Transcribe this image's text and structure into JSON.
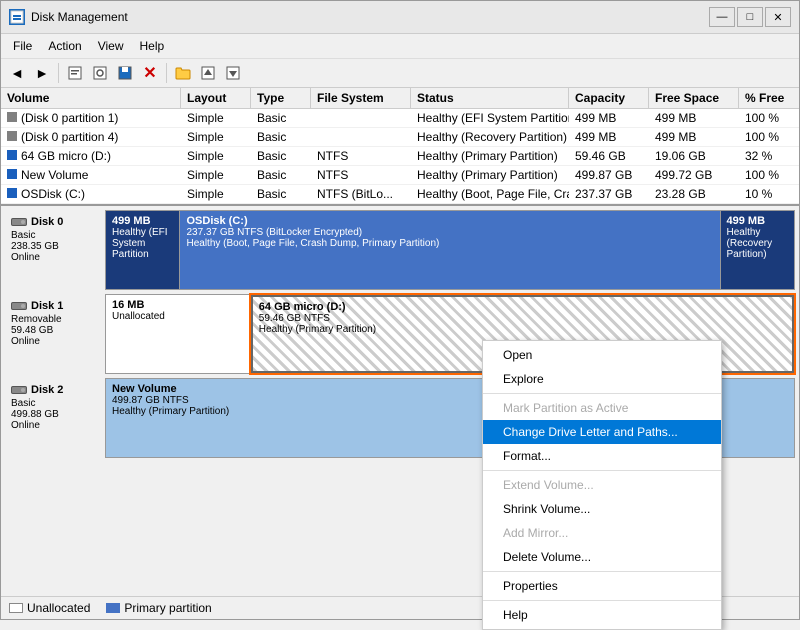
{
  "window": {
    "title": "Disk Management",
    "controls": {
      "minimize": "—",
      "maximize": "□",
      "close": "✕"
    }
  },
  "menu": {
    "items": [
      "File",
      "Action",
      "View",
      "Help"
    ]
  },
  "toolbar": {
    "buttons": [
      "◄",
      "►",
      "📄",
      "🔧",
      "💾",
      "✕",
      "📁",
      "⬆",
      "⬇"
    ]
  },
  "table": {
    "headers": [
      "Volume",
      "Layout",
      "Type",
      "File System",
      "Status",
      "Capacity",
      "Free Space",
      "% Free"
    ],
    "rows": [
      {
        "volume": "(Disk 0 partition 1)",
        "layout": "Simple",
        "type": "Basic",
        "fs": "",
        "status": "Healthy (EFI System Partition)",
        "capacity": "499 MB",
        "free": "499 MB",
        "pct": "100 %"
      },
      {
        "volume": "(Disk 0 partition 4)",
        "layout": "Simple",
        "type": "Basic",
        "fs": "",
        "status": "Healthy (Recovery Partition)",
        "capacity": "499 MB",
        "free": "499 MB",
        "pct": "100 %"
      },
      {
        "volume": "64 GB micro (D:)",
        "layout": "Simple",
        "type": "Basic",
        "fs": "NTFS",
        "status": "Healthy (Primary Partition)",
        "capacity": "59.46 GB",
        "free": "19.06 GB",
        "pct": "32 %"
      },
      {
        "volume": "New Volume",
        "layout": "Simple",
        "type": "Basic",
        "fs": "NTFS",
        "status": "Healthy (Primary Partition)",
        "capacity": "499.87 GB",
        "free": "499.72 GB",
        "pct": "100 %"
      },
      {
        "volume": "OSDisk (C:)",
        "layout": "Simple",
        "type": "Basic",
        "fs": "NTFS (BitLo...",
        "status": "Healthy (Boot, Page File, Crash Dump, Primary Partition)",
        "capacity": "237.37 GB",
        "free": "23.28 GB",
        "pct": "10 %"
      }
    ]
  },
  "disks": [
    {
      "id": "Disk 0",
      "type": "Basic",
      "size": "238.35 GB",
      "status": "Online",
      "partitions": [
        {
          "name": "499 MB",
          "info": "Healthy (EFI System Partition",
          "type": "dark-blue",
          "width": "7"
        },
        {
          "name": "OSDisk (C:)",
          "info2": "237.37 GB NTFS (BitLocker Encrypted)",
          "info": "Healthy (Boot, Page File, Crash Dump, Primary Partition)",
          "type": "medium-blue",
          "width": "60"
        },
        {
          "name": "499 MB",
          "info": "Healthy (Recovery Partition)",
          "type": "dark-blue",
          "width": "7"
        }
      ]
    },
    {
      "id": "Disk 1",
      "type": "Removable",
      "size": "59.48 GB",
      "status": "Online",
      "partitions": [
        {
          "name": "16 MB",
          "info": "Unallocated",
          "type": "unalloc",
          "width": "15"
        },
        {
          "name": "64 GB micro (D:)",
          "info2": "59.46 GB NTFS",
          "info": "Healthy (Primary Partition)",
          "type": "striped",
          "width": "60",
          "selected": true
        }
      ]
    },
    {
      "id": "Disk 2",
      "type": "Basic",
      "size": "499.88 GB",
      "status": "Online",
      "partitions": [
        {
          "name": "New Volume",
          "info2": "499.87 GB NTFS",
          "info": "Healthy (Primary Partition)",
          "type": "light-blue",
          "width": "85"
        }
      ]
    }
  ],
  "context_menu": {
    "items": [
      {
        "label": "Open",
        "disabled": false
      },
      {
        "label": "Explore",
        "disabled": false
      },
      {
        "separator": true
      },
      {
        "label": "Mark Partition as Active",
        "disabled": true
      },
      {
        "label": "Change Drive Letter and Paths...",
        "disabled": false,
        "highlighted": true
      },
      {
        "label": "Format...",
        "disabled": false
      },
      {
        "separator": true
      },
      {
        "label": "Extend Volume...",
        "disabled": true
      },
      {
        "label": "Shrink Volume...",
        "disabled": false
      },
      {
        "label": "Add Mirror...",
        "disabled": true
      },
      {
        "label": "Delete Volume...",
        "disabled": false
      },
      {
        "separator": true
      },
      {
        "label": "Properties",
        "disabled": false
      },
      {
        "separator": true
      },
      {
        "label": "Help",
        "disabled": false
      }
    ]
  },
  "legend": {
    "unallocated": "Unallocated",
    "primary": "Primary partition"
  }
}
